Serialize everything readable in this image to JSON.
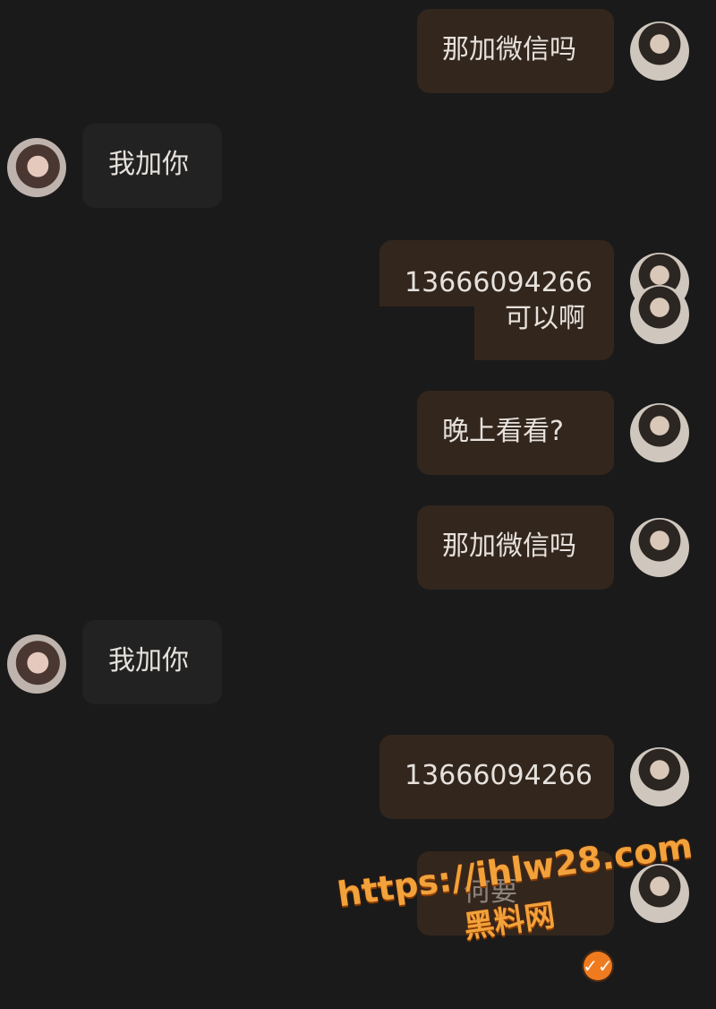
{
  "messages": [
    {
      "side": "right",
      "text": "那加微信吗"
    },
    {
      "side": "left",
      "text": "我加你"
    },
    {
      "side": "right",
      "text": "13666094266"
    },
    {
      "side": "right",
      "text": "可以啊"
    },
    {
      "side": "right",
      "text": "晚上看看?"
    },
    {
      "side": "right",
      "text": "那加微信吗"
    },
    {
      "side": "left",
      "text": "我加你"
    },
    {
      "side": "right",
      "text": "13666094266"
    },
    {
      "side": "right",
      "text": "何要"
    }
  ],
  "watermark": {
    "url": "https://ihlw28.com",
    "site": "黑料网"
  },
  "status_icon": "double-check-icon"
}
